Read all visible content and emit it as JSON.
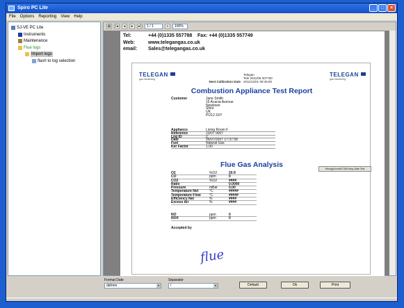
{
  "window": {
    "title": "Spiro PC Lite"
  },
  "menu": [
    "File",
    "Options",
    "Reporting",
    "View",
    "Help"
  ],
  "tree": [
    {
      "label": "SJ-VE PC Lite",
      "indent": 0,
      "color": "#000000",
      "icon": "computer-icon"
    },
    {
      "label": "Instruments",
      "indent": 1,
      "color": "#000000",
      "icon": "instrument-icon"
    },
    {
      "label": "Maintenance",
      "indent": 1,
      "color": "#000000",
      "icon": "wrench-icon"
    },
    {
      "label": "Flue logs",
      "indent": 1,
      "color": "#2a8a2a",
      "icon": "folder-icon"
    },
    {
      "label": "Import logs",
      "indent": 2,
      "color": "#000000",
      "icon": "import-icon",
      "selected": true
    },
    {
      "label": "flash to log selection",
      "indent": 3,
      "color": "#000000",
      "icon": "log-icon"
    }
  ],
  "toolbar": {
    "page_field": "1 / 1",
    "zoom_field": "100%"
  },
  "contact": {
    "tel_label": "Tel:",
    "tel": "+44 (0)1335 557788",
    "fax_label": "Fax:",
    "fax": "+44 (0)1335 557749",
    "web_label": "Web:",
    "web": "www.telegangas.co.uk",
    "email_label": "email:",
    "email": "Sales@telegangas.co.uk"
  },
  "report": {
    "brand": "TELEGAN",
    "brand_sub": "gas monitoring",
    "hdr": [
      {
        "k": "",
        "v": "Telegan"
      },
      {
        "k": "",
        "v": "Tele 2011/08 007750"
      },
      {
        "k": "Next Calibration Date",
        "v": "2011/12/01   09:45:00"
      }
    ],
    "title": "Combustion Appliance Test Report",
    "customer_label": "Customer",
    "customer_lines": [
      "Jane Smith",
      "15 Acacia Avenue",
      "Newtown",
      "Shire",
      "UK",
      "PO12 3XY"
    ],
    "details": [
      {
        "k": "Appliance",
        "v": "Living Room F"
      },
      {
        "k": "Reference",
        "v": "23/07 0007"
      },
      {
        "k": "Log ID",
        "v": "2"
      },
      {
        "k": "Date",
        "v": "05/07/2007  17:37:58"
      },
      {
        "k": "Fuel",
        "v": "Natural Gas"
      },
      {
        "k": "Ker Factor",
        "v": "1.00"
      }
    ],
    "print_button": "Wrongly Invalid T&W Assy Date Test",
    "section2": "Flue Gas Analysis",
    "measurements": [
      {
        "k": "O2",
        "u": "%O2",
        "v": "20.9"
      },
      {
        "k": "CO",
        "u": "ppm",
        "v": "0"
      },
      {
        "k": "CO2",
        "u": "%O2",
        "v": "####"
      },
      {
        "k": "Ratio",
        "u": "",
        "v": "0.0000"
      },
      {
        "k": "Pressure",
        "u": "mBar",
        "v": "0.00"
      },
      {
        "k": "Temperature Net",
        "u": "°C",
        "v": "#####"
      },
      {
        "k": "Temperature Flow",
        "u": "°C",
        "v": "#####"
      },
      {
        "k": "Efficiency  Net",
        "u": "%",
        "v": "####"
      },
      {
        "k": "Excess Air",
        "u": "%",
        "v": "####"
      }
    ],
    "extra": [
      {
        "k": "NO",
        "u": "ppm",
        "v": "0"
      },
      {
        "k": "NOX",
        "u": "ppm",
        "v": "0"
      }
    ],
    "accepted_label": "Accepted by",
    "signature": "flue"
  },
  "bottom": {
    "label1": "Format Date",
    "select1": "dd/mm",
    "label2": "Separator",
    "select2": "/",
    "btn_default": "Default",
    "btn_ok": "Ok",
    "btn_print": "Print"
  }
}
